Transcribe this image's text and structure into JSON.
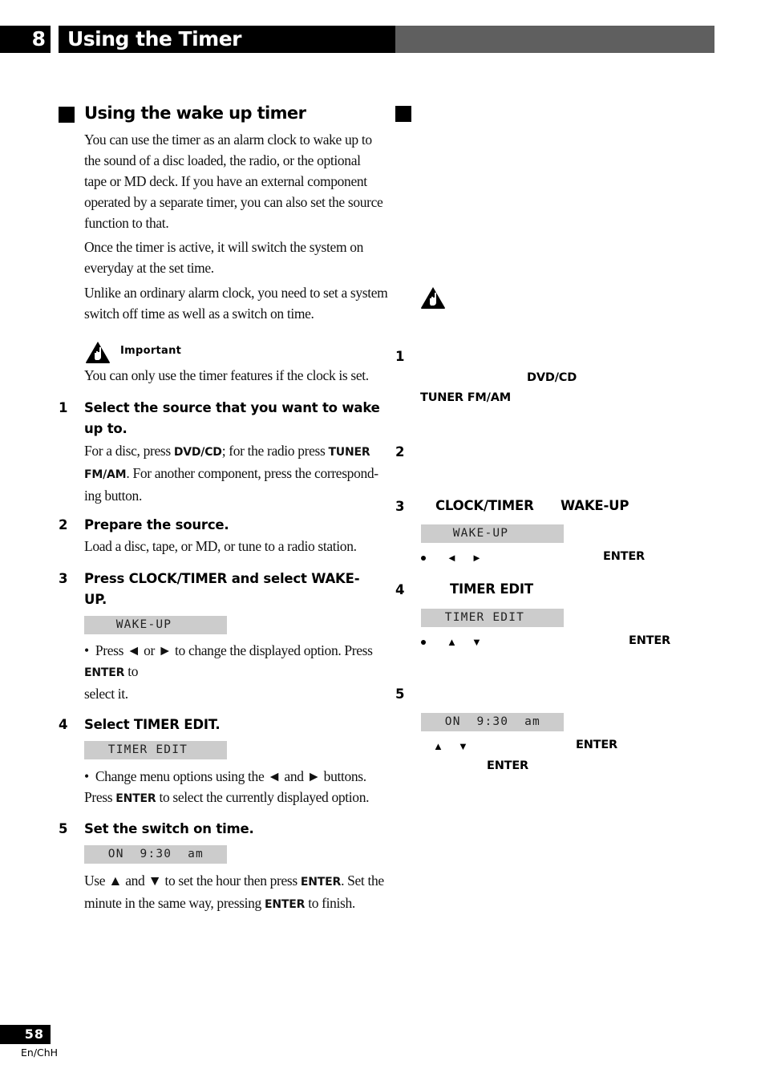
{
  "header": {
    "chapter_number": "8",
    "chapter_title": "Using the Timer"
  },
  "left": {
    "heading": "Using the wake up timer",
    "intro": [
      [
        "You can use the timer as an alarm clock to wake up to",
        "the sound of a disc loaded, the radio, or the optional",
        "tape or MD deck. If you have an external component",
        "operated by a separate timer, you can also set the source",
        "function to that."
      ],
      [
        "Once the timer is active, it will switch the system on",
        "everyday at the set time."
      ],
      [
        "Unlike an ordinary alarm clock, you need to set a system",
        "switch off time as well as a switch on time."
      ]
    ],
    "important": {
      "label": "Important",
      "icon": "warning-hand-icon",
      "text": "You can only use the timer features if the clock is set."
    },
    "steps": [
      {
        "number": "1",
        "title_lines": [
          "Select the source that you want to wake",
          "up to."
        ],
        "body": {
          "l1_a": "For a disc, press ",
          "l1_k1": "DVD/CD",
          "l1_b": "; for the radio press ",
          "l1_k2": "TUNER",
          "l2_k": "FM/AM",
          "l2_a": ". For another component, press the correspond-",
          "l3": "ing button."
        }
      },
      {
        "number": "2",
        "title_lines": [
          "Prepare the source."
        ],
        "body": {
          "l1": "Load a disc, tape, or MD, or tune to a radio station."
        }
      },
      {
        "number": "3",
        "title_lines": [
          "Press CLOCK/TIMER and select WAKE-",
          "UP."
        ],
        "display": "    WAKE-UP",
        "body": {
          "bullet": "•",
          "l1_a": "Press ",
          "l1_g1": "◄",
          "l1_b": " or ",
          "l1_g2": "►",
          "l1_c": " to change the displayed option. Press",
          "l2_k": "ENTER",
          "l2_a": " to",
          "l3": "select it."
        }
      },
      {
        "number": "4",
        "title_lines": [
          "Select TIMER EDIT."
        ],
        "display": "   TIMER EDIT",
        "body": {
          "bullet": "•",
          "l1_a": "Change menu options using the ",
          "l1_g1": "◄",
          "l1_b": " and ",
          "l1_g2": "►",
          "l1_c": " buttons.",
          "l2_a": "Press ",
          "l2_k": "ENTER",
          "l2_b": " to select the currently displayed option."
        }
      },
      {
        "number": "5",
        "title_lines": [
          "Set the switch on time."
        ],
        "display": "   ON  9:30  am",
        "body": {
          "l1_a": "Use ",
          "l1_g1": "▲",
          "l1_b": " and ",
          "l1_g2": "▼",
          "l1_c": " to set the hour then press ",
          "l1_k": "ENTER",
          "l1_d": ". Set the",
          "l2_a": "minute in the same way, pressing ",
          "l2_k": "ENTER",
          "l2_b": " to finish."
        }
      }
    ]
  },
  "right": {
    "important_icon": "warning-hand-icon",
    "steps": [
      {
        "number": "1",
        "kw1": "DVD/CD",
        "kw2": "TUNER FM/AM"
      },
      {
        "number": "2"
      },
      {
        "number": "3",
        "kw1": "CLOCK/TIMER",
        "kw2": "WAKE-UP",
        "display": "    WAKE-UP",
        "bullet": "•",
        "g1": "◄",
        "g2": "►",
        "kw3": "ENTER"
      },
      {
        "number": "4",
        "kw1": "TIMER EDIT",
        "display": "   TIMER EDIT",
        "bullet": "•",
        "g1": "▲",
        "g2": "▼",
        "kw2": "ENTER"
      },
      {
        "number": "5",
        "display": "   ON  9:30  am",
        "g1": "▲",
        "g2": "▼",
        "kw1": "ENTER",
        "kw2": "ENTER"
      }
    ]
  },
  "footer": {
    "page_number": "58",
    "language_code": "En/ChH"
  }
}
